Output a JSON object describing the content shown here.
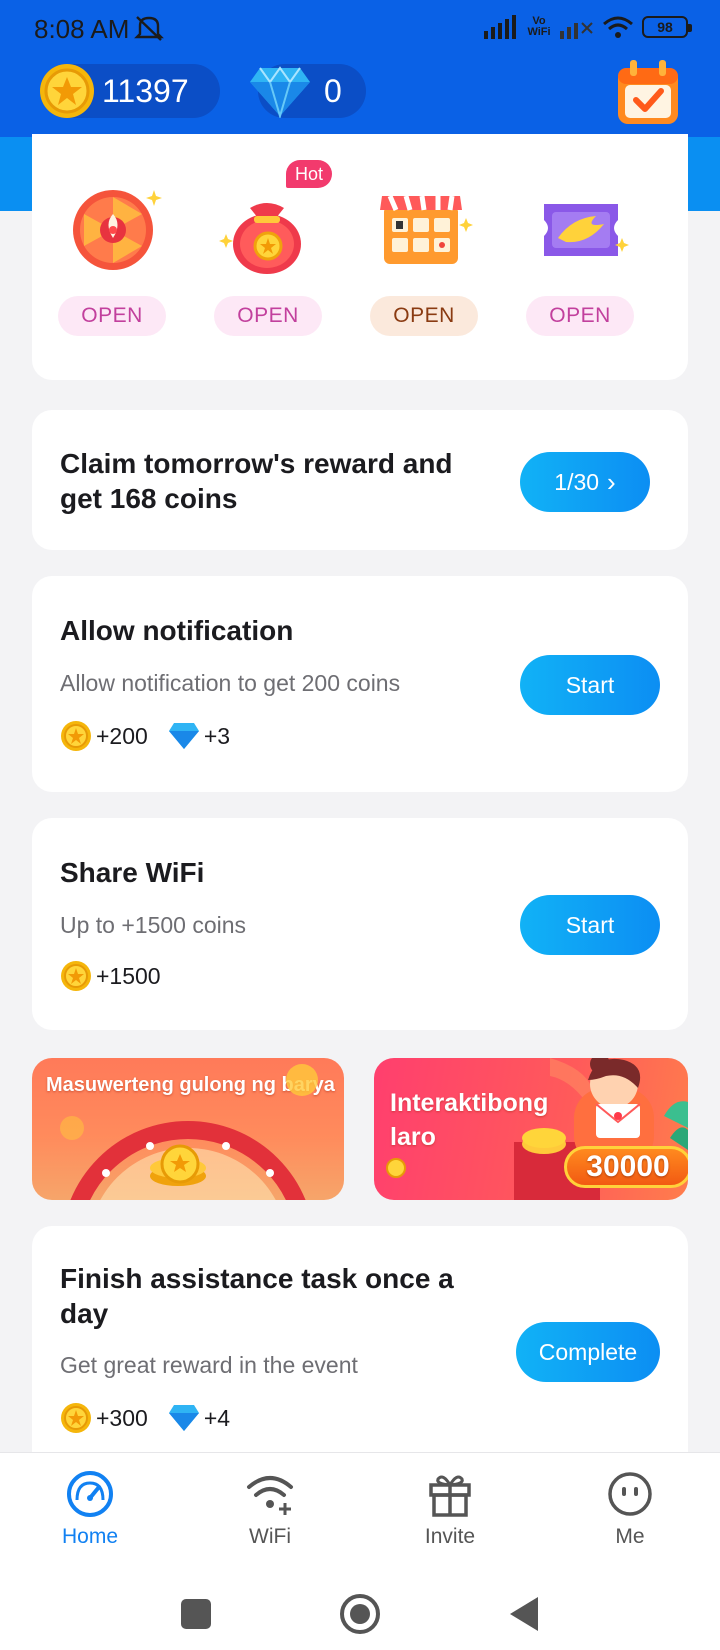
{
  "status_bar": {
    "time": "8:08 AM",
    "network_label": "Vo WiFi",
    "battery": "98"
  },
  "header": {
    "coins": "11397",
    "gems": "0",
    "icons": [
      "coin-icon",
      "diamond-icon",
      "calendar-check-icon"
    ]
  },
  "features": {
    "hot_badge": "Hot",
    "items": [
      {
        "icon": "lucky-wheel-icon",
        "button": "OPEN",
        "btn_bg": "#fde8f6",
        "btn_color": "#c2409d"
      },
      {
        "icon": "money-bag-icon",
        "button": "OPEN",
        "btn_bg": "#fde8f6",
        "btn_color": "#c2409d"
      },
      {
        "icon": "shop-grid-icon",
        "button": "OPEN",
        "btn_bg": "#fbe9dc",
        "btn_color": "#8a3b12"
      },
      {
        "icon": "ticket-icon",
        "button": "OPEN",
        "btn_bg": "#fde8f6",
        "btn_color": "#c2409d"
      }
    ]
  },
  "checkin": {
    "title_line1": "Claim tomorrow's reward and",
    "title_line2": "get 168 coins",
    "progress_label": "1/30",
    "chevron": "›"
  },
  "tasks": [
    {
      "title": "Allow notification",
      "subtitle": "Allow notification to get 200 coins",
      "coins": "+200",
      "gems": "+3",
      "button": "Start"
    },
    {
      "title": "Share WiFi",
      "subtitle": "Up to +1500  coins",
      "coins": "+1500",
      "button": "Start"
    },
    {
      "title_line1": "Finish assistance task once a",
      "title_line2": "day",
      "subtitle": "Get great reward in the event",
      "coins": "+300",
      "gems": "+4",
      "button": "Complete"
    }
  ],
  "banners": {
    "left": {
      "text": "Masuwerteng gulong ng barya"
    },
    "right": {
      "text_line1": "Interaktibong",
      "text_line2": "laro",
      "amount": "30000"
    }
  },
  "bottom_nav": [
    {
      "label": "Home",
      "icon": "speedometer-icon",
      "active": true
    },
    {
      "label": "WiFi",
      "icon": "wifi-plus-icon",
      "active": false
    },
    {
      "label": "Invite",
      "icon": "gift-icon",
      "active": false
    },
    {
      "label": "Me",
      "icon": "smiley-icon",
      "active": false
    }
  ],
  "colors": {
    "brand_blue": "#0a61e6",
    "accent_blue": "#1181f2",
    "button_gradient": [
      "#11b2f6",
      "#0c8ef3"
    ],
    "hot_pink": "#f23a6d"
  }
}
